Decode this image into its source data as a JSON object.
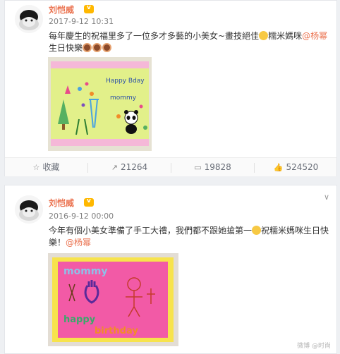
{
  "posts": [
    {
      "user": {
        "name": "刘恺威"
      },
      "time": "2017-9-12 10:31",
      "text_part1": "每年慶生的祝福里多了一位多才多藝的小美女~畫技絕佳",
      "text_part2": "糯米媽咪",
      "mention": "@杨幂",
      "text_line2": "生日快樂",
      "card_text": {
        "line1": "Happy Bday",
        "line2": "mommy"
      },
      "actions": [
        {
          "label": "收藏",
          "icon": "star-icon"
        },
        {
          "label": "21264",
          "icon": "share-icon"
        },
        {
          "label": "19828",
          "icon": "comment-icon"
        },
        {
          "label": "524520",
          "icon": "like-icon"
        }
      ]
    },
    {
      "user": {
        "name": "刘恺威"
      },
      "time": "2016-9-12 00:00",
      "text_part1": "今年有個小美女準備了手工大禮，我們都不跟她搶第一",
      "text_part2": "祝糯米媽咪生日快",
      "text_line2_part1": "樂！",
      "mention": "@杨幂",
      "card_text": {
        "line1": "mommy",
        "line2": "happy",
        "line3": "birthday"
      }
    }
  ],
  "watermark": "微博 @时尚"
}
